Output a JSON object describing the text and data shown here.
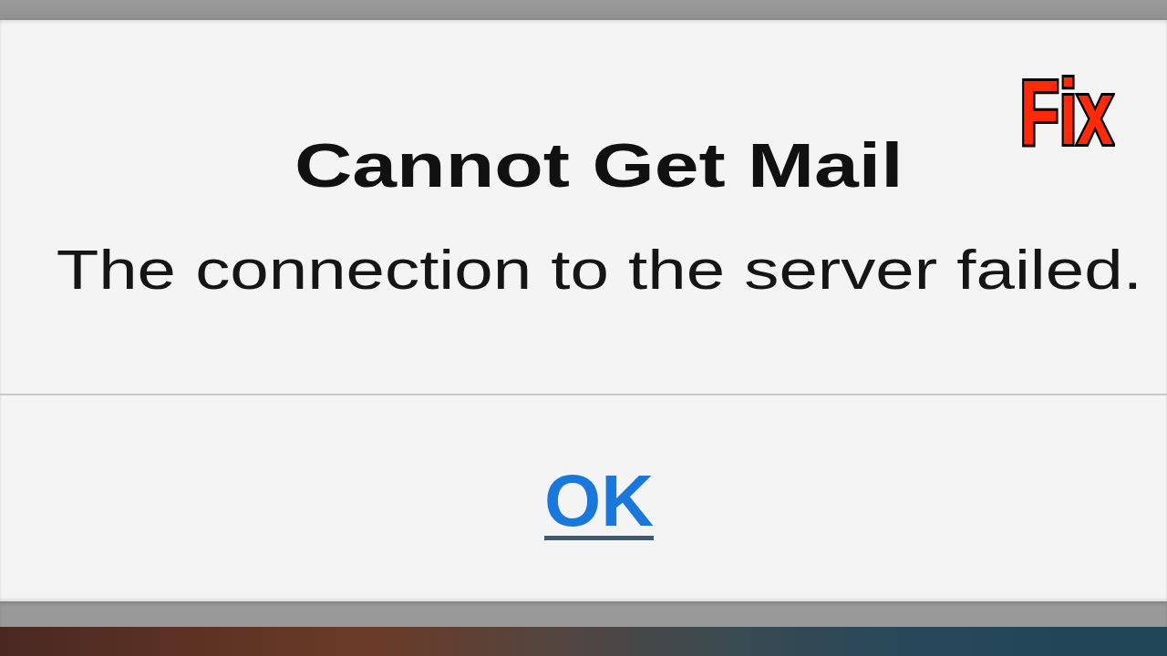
{
  "alert": {
    "title": "Cannot Get Mail",
    "message": "The connection to the server failed.",
    "buttons": [
      {
        "label": "OK",
        "focused": true
      }
    ]
  },
  "overlay_label": {
    "text": "Fix"
  }
}
